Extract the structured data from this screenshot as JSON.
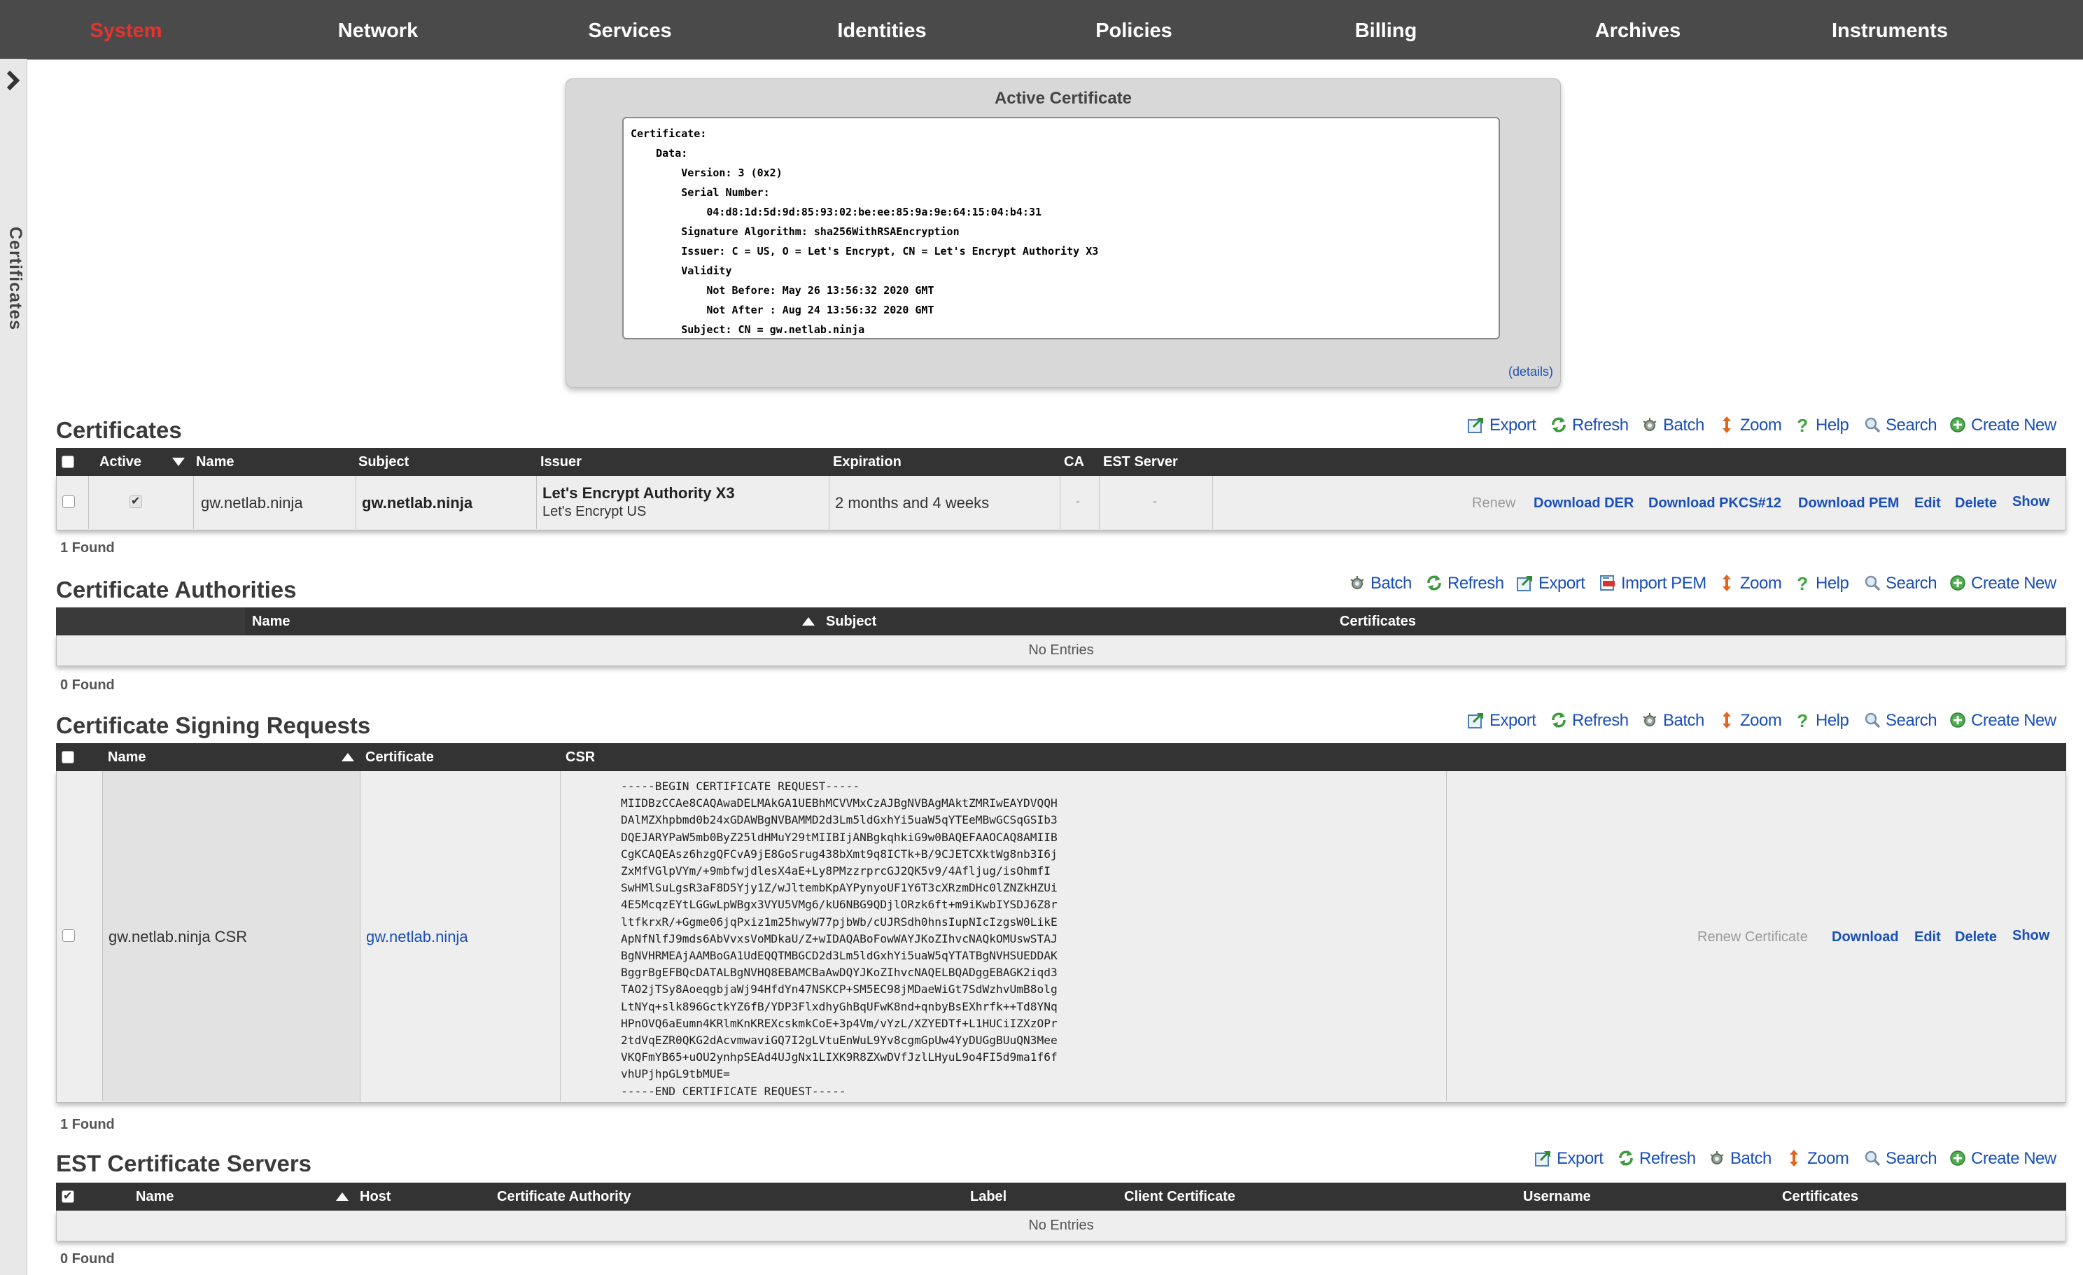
{
  "nav": {
    "items": [
      "System",
      "Network",
      "Services",
      "Identities",
      "Policies",
      "Billing",
      "Archives",
      "Instruments"
    ],
    "active": "System",
    "active_color": "#e3342f"
  },
  "sidebar": {
    "label": "Certificates",
    "toggle_icon": "chevron-right-icon"
  },
  "active_certificate": {
    "title": "Active Certificate",
    "text": "Certificate:\n    Data:\n        Version: 3 (0x2)\n        Serial Number:\n            04:d8:1d:5d:9d:85:93:02:be:ee:85:9a:9e:64:15:04:b4:31\n        Signature Algorithm: sha256WithRSAEncryption\n        Issuer: C = US, O = Let's Encrypt, CN = Let's Encrypt Authority X3\n        Validity\n            Not Before: May 26 13:56:32 2020 GMT\n            Not After : Aug 24 13:56:32 2020 GMT\n        Subject: CN = gw.netlab.ninja",
    "details_link": "(details)"
  },
  "toolbar_labels": {
    "export": "Export",
    "refresh": "Refresh",
    "batch": "Batch",
    "zoom": "Zoom",
    "help": "Help",
    "search": "Search",
    "create_new": "Create New",
    "import_pem": "Import PEM"
  },
  "certificates": {
    "title": "Certificates",
    "columns": [
      "Active",
      "Name",
      "Subject",
      "Issuer",
      "Expiration",
      "CA",
      "EST Server"
    ],
    "rows": [
      {
        "name": "gw.netlab.ninja",
        "subject": "gw.netlab.ninja",
        "issuer_cn": "Let's Encrypt Authority X3",
        "issuer_org": "Let's Encrypt US",
        "expiration": "2 months and 4 weeks",
        "ca": "-",
        "est_server": "-",
        "actions": [
          "Renew",
          "Download DER",
          "Download PKCS#12",
          "Download PEM",
          "Edit",
          "Delete",
          "Show"
        ]
      }
    ],
    "found": "1 Found"
  },
  "certificate_authorities": {
    "title": "Certificate Authorities",
    "columns": [
      "Name",
      "Subject",
      "Certificates"
    ],
    "empty": "No Entries",
    "found": "0 Found"
  },
  "csr": {
    "title": "Certificate Signing Requests",
    "columns": [
      "Name",
      "Certificate",
      "CSR"
    ],
    "rows": [
      {
        "name": "gw.netlab.ninja CSR",
        "certificate": "gw.netlab.ninja",
        "csr": "-----BEGIN CERTIFICATE REQUEST-----\nMIIDBzCCAe8CAQAwaDELMAkGA1UEBhMCVVMxCzAJBgNVBAgMAktZMRIwEAYDVQQH\nDAlMZXhpbmd0b24xGDAWBgNVBAMMD2d3Lm5ldGxhYi5uaW5qYTEeMBwGCSqGSIb3\nDQEJARYPaW5mb0ByZ25ldHMuY29tMIIBIjANBgkqhkiG9w0BAQEFAAOCAQ8AMIIB\nCgKCAQEAsz6hzgQFCvA9jE8GoSrug438bXmt9q8ICTk+B/9CJETCXktWg8nb3I6j\nZxMfVGlpVYm/+9mbfwjdlesX4aE+Ly8PMzzrprcGJ2QK5v9/4Afljug/isOhmfI\nSwHMlSuLgsR3aF8D5Yjy1Z/wJltembKpAYPynyoUF1Y6T3cXRzmDHc0lZNZkHZUi\n4E5McqzEYtLGGwLpWBgx3VYU5VMg6/kU6NBG9QDjlORzk6ft+m9iKwbIYSDJ6Z8r\nltfkrxR/+Ggme06jqPxiz1m25hwyW77pjbWb/cUJRSdh0hnsIupNIcIzgsW0LikE\nApNfNlfJ9mds6AbVvxsVoMDkaU/Z+wIDAQABoFowWAYJKoZIhvcNAQkOMUswSTAJ\nBgNVHRMEAjAAMBoGA1UdEQQTMBGCD2d3Lm5ldGxhYi5uaW5qYTATBgNVHSUEDDAK\nBggrBgEFBQcDATALBgNVHQ8EBAMCBaAwDQYJKoZIhvcNAQELBQADggEBAGK2iqd3\nTAO2jTSy8AoeqgbjaWj94HfdYn47NSKCP+SM5EC98jMDaeWiGt7SdWzhvUmB8olg\nLtNYq+slk896GctkYZ6fB/YDP3FlxdhyGhBqUFwK8nd+qnbyBsEXhrfk++Td8YNq\nHPnOVQ6aEumn4KRlmKnKREXcskmkCoE+3p4Vm/vYzL/XZYEDTf+L1HUCiIZXzOPr\n2tdVqEZR0QKG2dAcvmwaviGQ7I2gLVtuEnWuL9Yv8cgmGpUw4YyDUGgBUuQN3Mee\nVKQFmYB65+uOU2ynhpSEAd4UJgNx1LIXK9R8ZXwDVfJzlLHyuL9o4FI5d9ma1f6f\nvhUPjhpGL9tbMUE=\n-----END CERTIFICATE REQUEST-----",
        "actions": [
          "Renew Certificate",
          "Download",
          "Edit",
          "Delete",
          "Show"
        ]
      }
    ],
    "found": "1 Found"
  },
  "est_servers": {
    "title": "EST Certificate Servers",
    "columns": [
      "Name",
      "Host",
      "Certificate Authority",
      "Label",
      "Client Certificate",
      "Username",
      "Certificates"
    ],
    "empty": "No Entries",
    "found": "0 Found"
  },
  "colors": {
    "link": "#1a4fb8",
    "header_bg": "#333333",
    "nav_bg": "#4a4a4a",
    "disabled": "#9a9a9a"
  },
  "icons": [
    "export-icon",
    "refresh-icon",
    "batch-icon",
    "zoom-icon",
    "help-icon",
    "search-icon",
    "create-new-icon",
    "import-pem-icon"
  ]
}
